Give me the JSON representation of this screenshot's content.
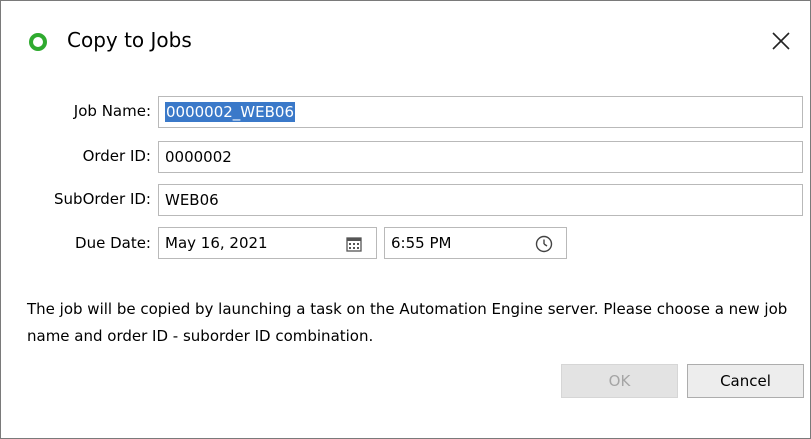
{
  "dialog": {
    "title": "Copy to Jobs",
    "app_icon": "green-ring-icon",
    "close_icon": "close-icon",
    "accent_color": "#2faa2f"
  },
  "form": {
    "job_name_label": "Job Name:",
    "job_name_value": "0000002_WEB06",
    "order_id_label": "Order ID:",
    "order_id_value": "0000002",
    "suborder_id_label": "SubOrder ID:",
    "suborder_id_value": "WEB06",
    "due_date_label": "Due Date:",
    "due_date_value": "May 16, 2021",
    "due_time_value": "6:55 PM",
    "calendar_icon": "calendar-icon",
    "clock_icon": "clock-icon"
  },
  "message": "The job will be copied by launching a task on the Automation Engine server. Please choose a new job name and order ID - suborder ID combination.",
  "buttons": {
    "ok_label": "OK",
    "cancel_label": "Cancel"
  }
}
